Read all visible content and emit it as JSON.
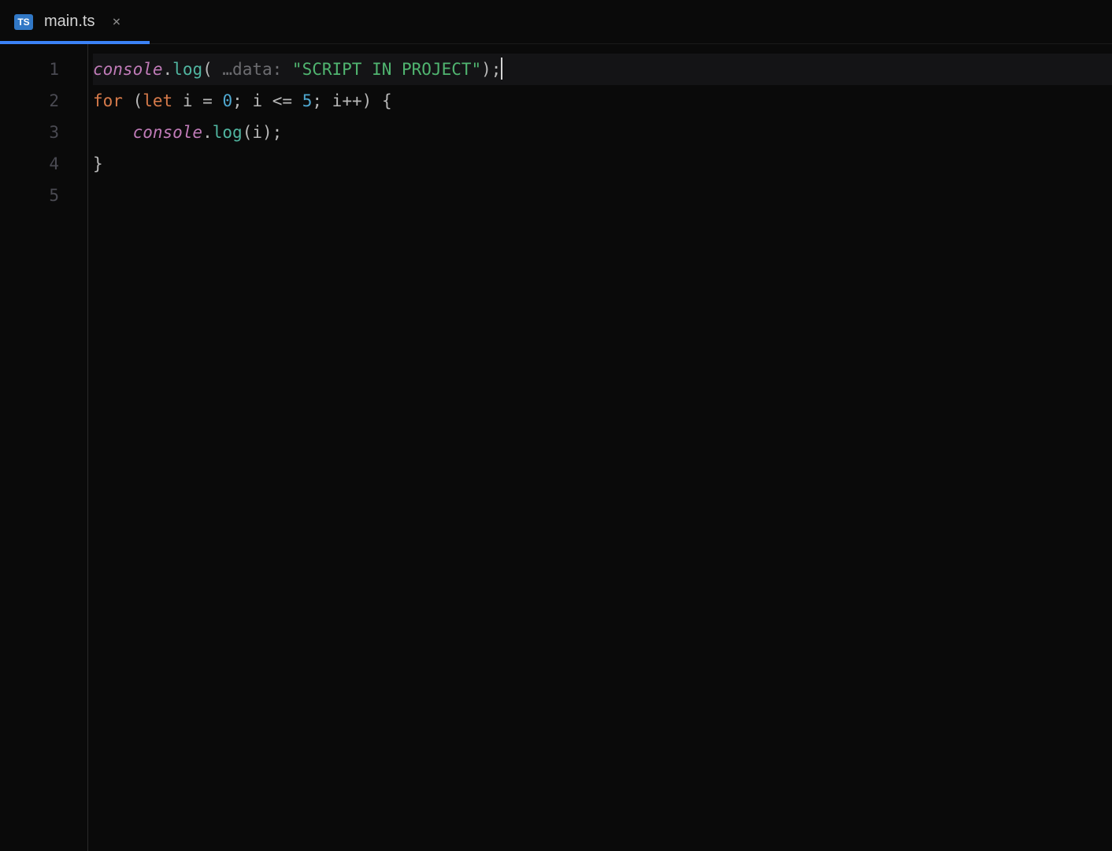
{
  "tab": {
    "icon_label": "TS",
    "title": "main.ts",
    "close_glyph": "×"
  },
  "gutter": {
    "lines": [
      "1",
      "2",
      "3",
      "4",
      "5"
    ]
  },
  "code": {
    "line1": {
      "obj": "console",
      "dot1": ".",
      "method": "log",
      "open": "(",
      "hint": " …data: ",
      "string": "\"SCRIPT IN PROJECT\"",
      "close": ")",
      "semi": ";"
    },
    "line2": {
      "kw_for": "for",
      "sp1": " ",
      "open": "(",
      "kw_let": "let",
      "sp2": " ",
      "var1": "i",
      "sp3": " ",
      "eq": "=",
      "sp4": " ",
      "num0": "0",
      "semi1": ";",
      "sp5": " ",
      "var2": "i",
      "sp6": " ",
      "lte": "<=",
      "sp7": " ",
      "num5": "5",
      "semi2": ";",
      "sp8": " ",
      "var3": "i",
      "inc": "++",
      "close": ")",
      "sp9": " ",
      "brace": "{"
    },
    "line3": {
      "indent": "    ",
      "obj": "console",
      "dot": ".",
      "method": "log",
      "open": "(",
      "arg": "i",
      "close": ")",
      "semi": ";"
    },
    "line4": {
      "brace": "}"
    }
  }
}
